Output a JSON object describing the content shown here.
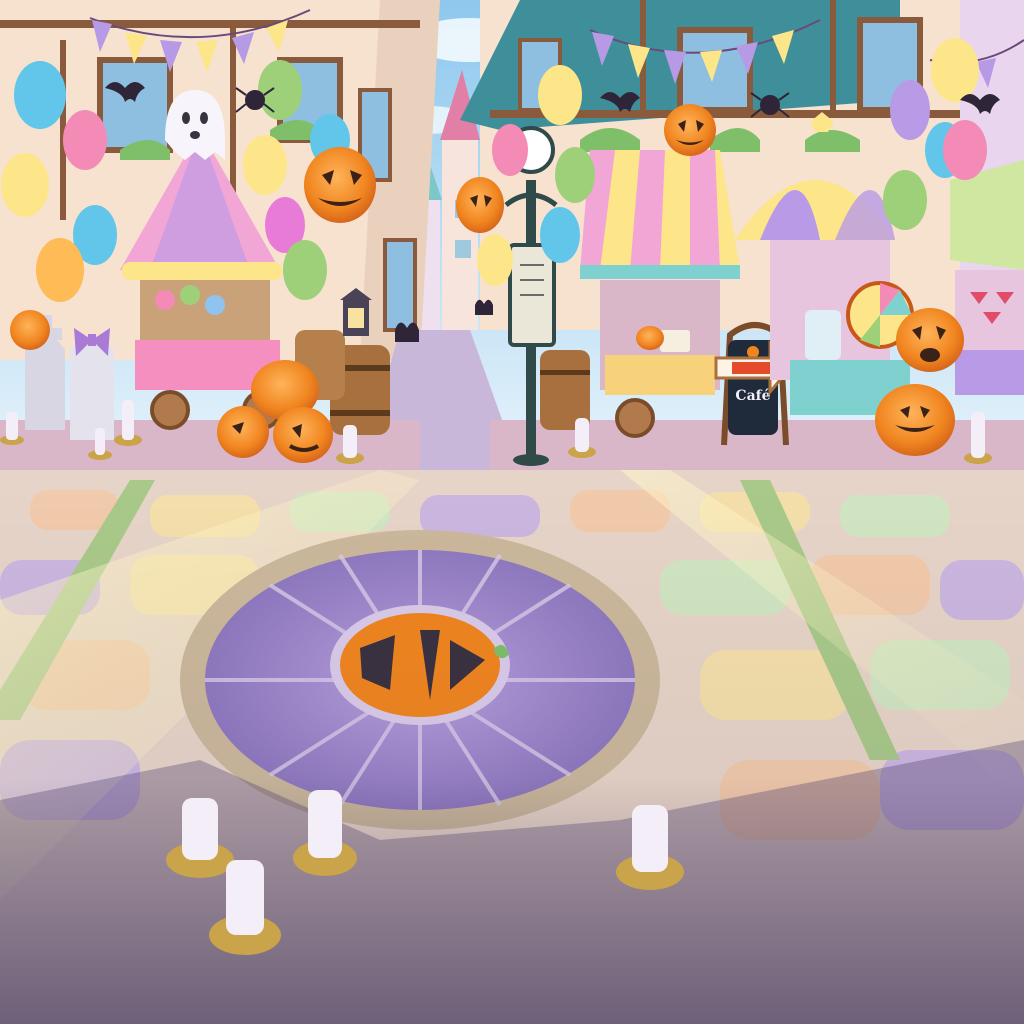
{
  "scene": {
    "cafe_sign_text": "Café",
    "menu_board_text": "",
    "palette": {
      "sky": "#9fd4f0",
      "cobble_warm": "#f3c9a8",
      "cobble_lilac": "#c9b3e2",
      "cobble_mint": "#cfe7c2",
      "mosaic_purple": "#9e86c9",
      "pumpkin": "#f0851f",
      "pumpkin_dark": "#c9561a",
      "awning_pink": "#f2a6d6",
      "awning_yellow": "#fde68a",
      "awning_purple": "#b89ae6",
      "candle": "#f3eef8",
      "shadow": "#5b4d78"
    },
    "icons": [
      "jack-o-lantern-icon",
      "ghost-icon",
      "bat-icon",
      "spider-icon",
      "candle-icon",
      "balloon-icon",
      "arrow-right-icon",
      "bow-icon"
    ]
  }
}
